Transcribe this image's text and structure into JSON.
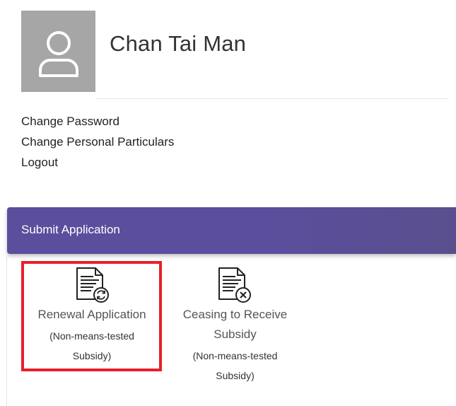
{
  "profile": {
    "name": "Chan Tai Man",
    "avatar_icon": "user-icon"
  },
  "account_menu": {
    "items": [
      {
        "label": "Change Password"
      },
      {
        "label": "Change Personal Particulars"
      },
      {
        "label": "Logout"
      }
    ]
  },
  "section": {
    "title": "Submit Application"
  },
  "applications": [
    {
      "title": "Renewal Application",
      "subtitle_lines": [
        "(Non-means-tested",
        "Subsidy)"
      ],
      "icon": "document-renew-icon",
      "highlighted": true
    },
    {
      "title_lines": [
        "Ceasing to Receive",
        "Subsidy"
      ],
      "subtitle_lines": [
        "(Non-means-tested",
        "Subsidy)"
      ],
      "icon": "document-cancel-icon",
      "highlighted": false
    }
  ],
  "colors": {
    "header_bg": "#5b4e9c",
    "highlight": "#e8202a",
    "avatar_bg": "#a6a6a6"
  }
}
